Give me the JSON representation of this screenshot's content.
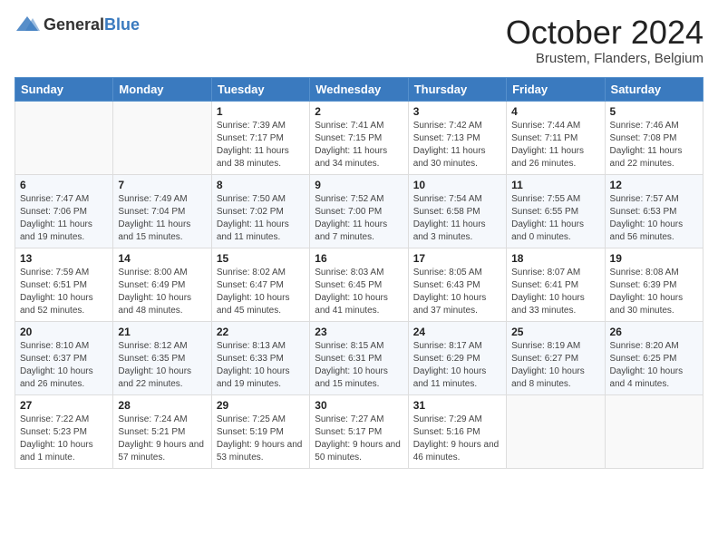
{
  "header": {
    "logo_general": "General",
    "logo_blue": "Blue",
    "month_title": "October 2024",
    "subtitle": "Brustem, Flanders, Belgium"
  },
  "days_of_week": [
    "Sunday",
    "Monday",
    "Tuesday",
    "Wednesday",
    "Thursday",
    "Friday",
    "Saturday"
  ],
  "weeks": [
    [
      {
        "day": "",
        "info": ""
      },
      {
        "day": "",
        "info": ""
      },
      {
        "day": "1",
        "info": "Sunrise: 7:39 AM\nSunset: 7:17 PM\nDaylight: 11 hours and 38 minutes."
      },
      {
        "day": "2",
        "info": "Sunrise: 7:41 AM\nSunset: 7:15 PM\nDaylight: 11 hours and 34 minutes."
      },
      {
        "day": "3",
        "info": "Sunrise: 7:42 AM\nSunset: 7:13 PM\nDaylight: 11 hours and 30 minutes."
      },
      {
        "day": "4",
        "info": "Sunrise: 7:44 AM\nSunset: 7:11 PM\nDaylight: 11 hours and 26 minutes."
      },
      {
        "day": "5",
        "info": "Sunrise: 7:46 AM\nSunset: 7:08 PM\nDaylight: 11 hours and 22 minutes."
      }
    ],
    [
      {
        "day": "6",
        "info": "Sunrise: 7:47 AM\nSunset: 7:06 PM\nDaylight: 11 hours and 19 minutes."
      },
      {
        "day": "7",
        "info": "Sunrise: 7:49 AM\nSunset: 7:04 PM\nDaylight: 11 hours and 15 minutes."
      },
      {
        "day": "8",
        "info": "Sunrise: 7:50 AM\nSunset: 7:02 PM\nDaylight: 11 hours and 11 minutes."
      },
      {
        "day": "9",
        "info": "Sunrise: 7:52 AM\nSunset: 7:00 PM\nDaylight: 11 hours and 7 minutes."
      },
      {
        "day": "10",
        "info": "Sunrise: 7:54 AM\nSunset: 6:58 PM\nDaylight: 11 hours and 3 minutes."
      },
      {
        "day": "11",
        "info": "Sunrise: 7:55 AM\nSunset: 6:55 PM\nDaylight: 11 hours and 0 minutes."
      },
      {
        "day": "12",
        "info": "Sunrise: 7:57 AM\nSunset: 6:53 PM\nDaylight: 10 hours and 56 minutes."
      }
    ],
    [
      {
        "day": "13",
        "info": "Sunrise: 7:59 AM\nSunset: 6:51 PM\nDaylight: 10 hours and 52 minutes."
      },
      {
        "day": "14",
        "info": "Sunrise: 8:00 AM\nSunset: 6:49 PM\nDaylight: 10 hours and 48 minutes."
      },
      {
        "day": "15",
        "info": "Sunrise: 8:02 AM\nSunset: 6:47 PM\nDaylight: 10 hours and 45 minutes."
      },
      {
        "day": "16",
        "info": "Sunrise: 8:03 AM\nSunset: 6:45 PM\nDaylight: 10 hours and 41 minutes."
      },
      {
        "day": "17",
        "info": "Sunrise: 8:05 AM\nSunset: 6:43 PM\nDaylight: 10 hours and 37 minutes."
      },
      {
        "day": "18",
        "info": "Sunrise: 8:07 AM\nSunset: 6:41 PM\nDaylight: 10 hours and 33 minutes."
      },
      {
        "day": "19",
        "info": "Sunrise: 8:08 AM\nSunset: 6:39 PM\nDaylight: 10 hours and 30 minutes."
      }
    ],
    [
      {
        "day": "20",
        "info": "Sunrise: 8:10 AM\nSunset: 6:37 PM\nDaylight: 10 hours and 26 minutes."
      },
      {
        "day": "21",
        "info": "Sunrise: 8:12 AM\nSunset: 6:35 PM\nDaylight: 10 hours and 22 minutes."
      },
      {
        "day": "22",
        "info": "Sunrise: 8:13 AM\nSunset: 6:33 PM\nDaylight: 10 hours and 19 minutes."
      },
      {
        "day": "23",
        "info": "Sunrise: 8:15 AM\nSunset: 6:31 PM\nDaylight: 10 hours and 15 minutes."
      },
      {
        "day": "24",
        "info": "Sunrise: 8:17 AM\nSunset: 6:29 PM\nDaylight: 10 hours and 11 minutes."
      },
      {
        "day": "25",
        "info": "Sunrise: 8:19 AM\nSunset: 6:27 PM\nDaylight: 10 hours and 8 minutes."
      },
      {
        "day": "26",
        "info": "Sunrise: 8:20 AM\nSunset: 6:25 PM\nDaylight: 10 hours and 4 minutes."
      }
    ],
    [
      {
        "day": "27",
        "info": "Sunrise: 7:22 AM\nSunset: 5:23 PM\nDaylight: 10 hours and 1 minute."
      },
      {
        "day": "28",
        "info": "Sunrise: 7:24 AM\nSunset: 5:21 PM\nDaylight: 9 hours and 57 minutes."
      },
      {
        "day": "29",
        "info": "Sunrise: 7:25 AM\nSunset: 5:19 PM\nDaylight: 9 hours and 53 minutes."
      },
      {
        "day": "30",
        "info": "Sunrise: 7:27 AM\nSunset: 5:17 PM\nDaylight: 9 hours and 50 minutes."
      },
      {
        "day": "31",
        "info": "Sunrise: 7:29 AM\nSunset: 5:16 PM\nDaylight: 9 hours and 46 minutes."
      },
      {
        "day": "",
        "info": ""
      },
      {
        "day": "",
        "info": ""
      }
    ]
  ]
}
